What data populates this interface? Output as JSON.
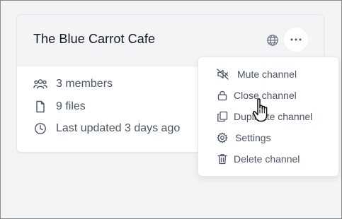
{
  "channel": {
    "title": "The Blue Carrot Cafe"
  },
  "meta": {
    "members": "3 members",
    "files": "9 files",
    "updated": "Last updated 3 days ago"
  },
  "menu": {
    "items": [
      {
        "label": "Mute channel",
        "icon": "mute-icon"
      },
      {
        "label": "Close channel",
        "icon": "lock-icon"
      },
      {
        "label": "Duplicate channel",
        "icon": "duplicate-icon"
      },
      {
        "label": "Settings",
        "icon": "gear-icon"
      },
      {
        "label": "Delete channel",
        "icon": "trash-icon"
      }
    ]
  },
  "header_icons": [
    "globe-icon",
    "more-icon"
  ],
  "colors": {
    "header_bg": "#f3f4f6",
    "card_bg": "#ffffff",
    "text_primary": "#111827",
    "text_muted": "#4b5563"
  }
}
